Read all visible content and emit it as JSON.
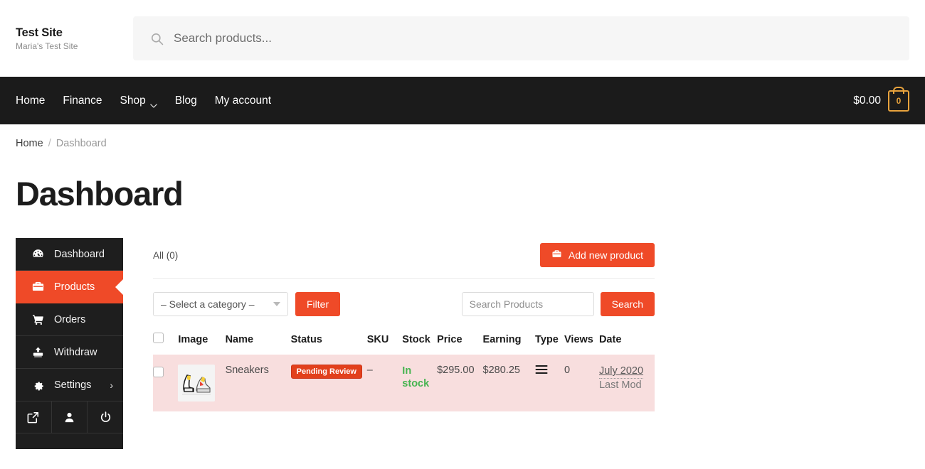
{
  "header": {
    "brand_title": "Test Site",
    "brand_subtitle": "Maria's Test Site",
    "search_placeholder": "Search products...",
    "search_value": "",
    "search_icon": "search-icon"
  },
  "nav": {
    "items": [
      {
        "label": "Home",
        "has_caret": false
      },
      {
        "label": "Finance",
        "has_caret": false
      },
      {
        "label": "Shop",
        "has_caret": true
      },
      {
        "label": "Blog",
        "has_caret": false
      },
      {
        "label": "My account",
        "has_caret": false
      }
    ],
    "cart_amount": "$0.00",
    "cart_count": "0",
    "cart_icon": "shopping-bag-icon",
    "cart_accent": "#e8a33d",
    "background": "#1b1b1b"
  },
  "breadcrumb": {
    "home": "Home",
    "separator": "/",
    "current": "Dashboard"
  },
  "page": {
    "title": "Dashboard"
  },
  "sidebar": {
    "items": [
      {
        "label": "Dashboard",
        "icon": "speedometer-icon",
        "active": false,
        "caret": ""
      },
      {
        "label": "Products",
        "icon": "briefcase-icon",
        "active": true,
        "caret": ""
      },
      {
        "label": "Orders",
        "icon": "shopping-cart-icon",
        "active": false,
        "caret": ""
      },
      {
        "label": "Withdraw",
        "icon": "upload-icon",
        "active": false,
        "caret": ""
      },
      {
        "label": "Settings",
        "icon": "gear-icon",
        "active": false,
        "caret": "›"
      }
    ],
    "footer_icons": [
      {
        "icon": "external-link-icon"
      },
      {
        "icon": "user-icon"
      },
      {
        "icon": "power-icon"
      }
    ],
    "active_color": "#ef4a28",
    "background": "#1e1e1e"
  },
  "toolbar": {
    "all_count": "All (0)",
    "add_label": "Add new product",
    "add_icon": "briefcase-icon",
    "category_value": "– Select a category –",
    "filter_label": "Filter",
    "search_placeholder": "Search Products",
    "search_value": "",
    "search_label": "Search",
    "accent": "#ef4a28"
  },
  "table": {
    "columns": [
      {
        "key": "checkbox",
        "label": ""
      },
      {
        "key": "image",
        "label": "Image"
      },
      {
        "key": "name",
        "label": "Name"
      },
      {
        "key": "status",
        "label": "Status"
      },
      {
        "key": "sku",
        "label": "SKU"
      },
      {
        "key": "stock",
        "label": "Stock"
      },
      {
        "key": "price",
        "label": "Price"
      },
      {
        "key": "earning",
        "label": "Earning"
      },
      {
        "key": "type",
        "label": "Type"
      },
      {
        "key": "views",
        "label": "Views"
      },
      {
        "key": "date",
        "label": "Date"
      }
    ],
    "rows": [
      {
        "name": "Sneakers",
        "status": "Pending Review",
        "status_color": "#e2401c",
        "sku": "–",
        "stock": "In stock",
        "stock_color": "#46b450",
        "price": "$295.00",
        "earning": "$280.25",
        "type_icon": "list-lines-icon",
        "views": "0",
        "date_link": "July 2020",
        "date_meta": "Last Mod",
        "image_alt": "sneakers-thumbnail",
        "row_background": "#f8dede"
      }
    ]
  }
}
